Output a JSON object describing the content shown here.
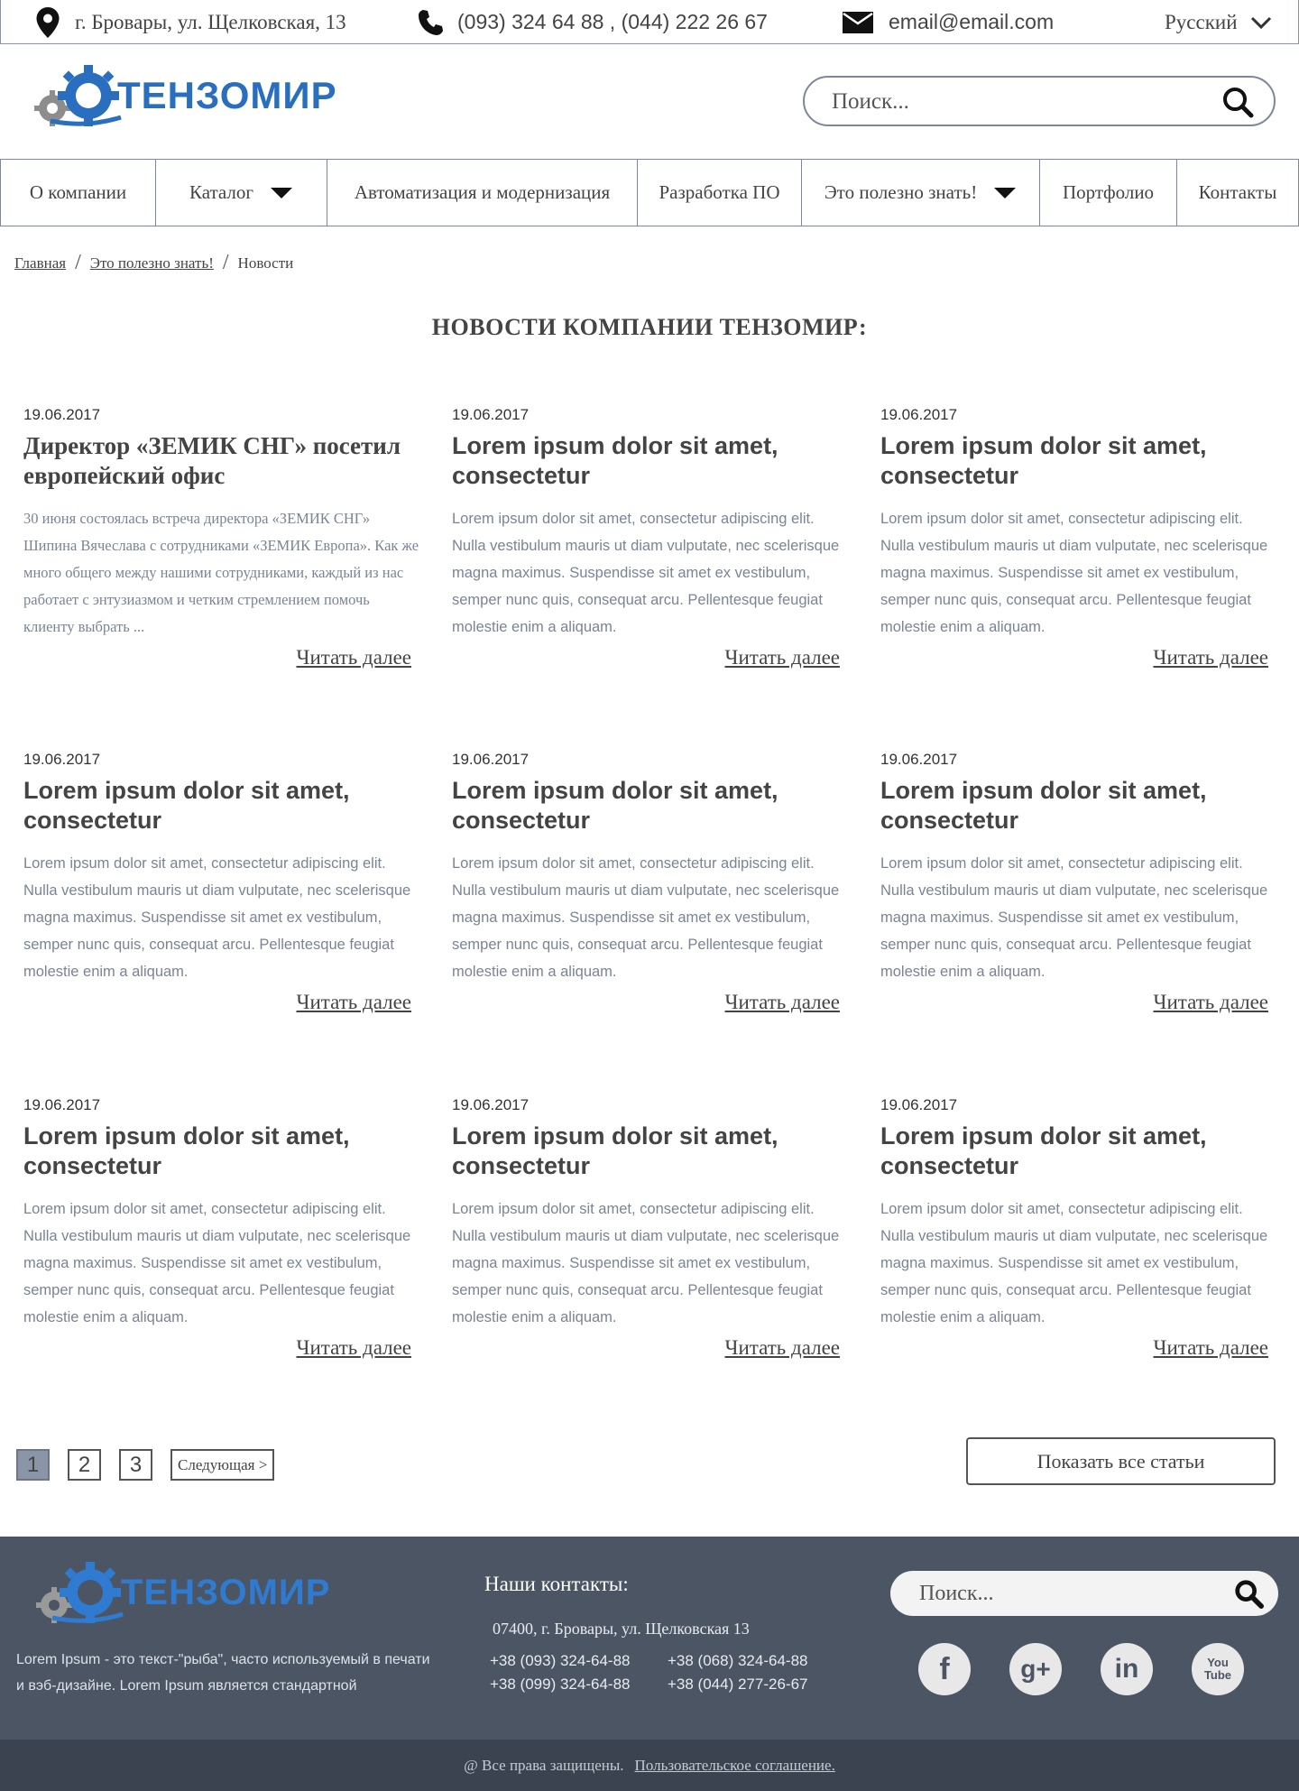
{
  "topbar": {
    "address": "г. Бровары, ул. Щелковская, 13",
    "phones": "(093) 324 64 88 , (044) 222 26 67",
    "email": "email@email.com",
    "language": "Русский"
  },
  "header": {
    "logo_text": "ТЕНЗОМИР",
    "search_placeholder": "Поиск..."
  },
  "nav": [
    {
      "label": "О компании",
      "dropdown": false
    },
    {
      "label": "Каталог",
      "dropdown": true
    },
    {
      "label": "Автоматизация и модернизация",
      "dropdown": false
    },
    {
      "label": "Разработка ПО",
      "dropdown": false
    },
    {
      "label": "Это полезно знать!",
      "dropdown": true
    },
    {
      "label": "Портфолио",
      "dropdown": false
    },
    {
      "label": "Контакты",
      "dropdown": false
    }
  ],
  "breadcrumb": {
    "home": "Главная",
    "section": "Это полезно знать!",
    "current": "Новости",
    "separator": "/"
  },
  "page_title": "НОВОСТИ КОМПАНИИ ТЕНЗОМИР:",
  "read_more": "Читать далее",
  "news": [
    {
      "date": "19.06.2017",
      "title": "Директор «ЗЕМИК СНГ» посетил европейский офис",
      "excerpt": "30 июня состоялась встреча директора «ЗЕМИК СНГ» Шипина Вячеслава с сотрудниками «ЗЕМИК Европа». Как же много общего между нашими сотрудниками, каждый из нас работает с энтузиазмом и четким стремлением помочь клиенту выбрать ..."
    },
    {
      "date": "19.06.2017",
      "title": "Lorem ipsum dolor sit amet, consectetur",
      "excerpt": "Lorem ipsum dolor sit amet, consectetur adipiscing elit. Nulla vestibulum mauris ut diam vulputate, nec scelerisque magna maximus. Suspendisse sit amet ex vestibulum, semper nunc quis, consequat arcu. Pellentesque feugiat molestie enim a aliquam."
    },
    {
      "date": "19.06.2017",
      "title": "Lorem ipsum dolor sit amet, consectetur",
      "excerpt": "Lorem ipsum dolor sit amet, consectetur adipiscing elit. Nulla vestibulum mauris ut diam vulputate, nec scelerisque magna maximus. Suspendisse sit amet ex vestibulum, semper nunc quis, consequat arcu. Pellentesque feugiat molestie enim a aliquam."
    },
    {
      "date": "19.06.2017",
      "title": "Lorem ipsum dolor sit amet, consectetur",
      "excerpt": "Lorem ipsum dolor sit amet, consectetur adipiscing elit. Nulla vestibulum mauris ut diam vulputate, nec scelerisque magna maximus. Suspendisse sit amet ex vestibulum, semper nunc quis, consequat arcu. Pellentesque feugiat molestie enim a aliquam."
    },
    {
      "date": "19.06.2017",
      "title": "Lorem ipsum dolor sit amet, consectetur",
      "excerpt": "Lorem ipsum dolor sit amet, consectetur adipiscing elit. Nulla vestibulum mauris ut diam vulputate, nec scelerisque magna maximus. Suspendisse sit amet ex vestibulum, semper nunc quis, consequat arcu. Pellentesque feugiat molestie enim a aliquam."
    },
    {
      "date": "19.06.2017",
      "title": "Lorem ipsum dolor sit amet, consectetur",
      "excerpt": "Lorem ipsum dolor sit amet, consectetur adipiscing elit. Nulla vestibulum mauris ut diam vulputate, nec scelerisque magna maximus. Suspendisse sit amet ex vestibulum, semper nunc quis, consequat arcu. Pellentesque feugiat molestie enim a aliquam."
    },
    {
      "date": "19.06.2017",
      "title": "Lorem ipsum dolor sit amet, consectetur",
      "excerpt": "Lorem ipsum dolor sit amet, consectetur adipiscing elit. Nulla vestibulum mauris ut diam vulputate, nec scelerisque magna maximus. Suspendisse sit amet ex vestibulum, semper nunc quis, consequat arcu. Pellentesque feugiat molestie enim a aliquam."
    },
    {
      "date": "19.06.2017",
      "title": "Lorem ipsum dolor sit amet, consectetur",
      "excerpt": "Lorem ipsum dolor sit amet, consectetur adipiscing elit. Nulla vestibulum mauris ut diam vulputate, nec scelerisque magna maximus. Suspendisse sit amet ex vestibulum, semper nunc quis, consequat arcu. Pellentesque feugiat molestie enim a aliquam."
    },
    {
      "date": "19.06.2017",
      "title": "Lorem ipsum dolor sit amet, consectetur",
      "excerpt": "Lorem ipsum dolor sit amet, consectetur adipiscing elit. Nulla vestibulum mauris ut diam vulputate, nec scelerisque magna maximus. Suspendisse sit amet ex vestibulum, semper nunc quis, consequat arcu. Pellentesque feugiat molestie enim a aliquam."
    }
  ],
  "pagination": {
    "pages": [
      "1",
      "2",
      "3"
    ],
    "current": "1",
    "next_label": "Следующая >"
  },
  "show_all_label": "Показать все статьи",
  "footer": {
    "logo_text": "ТЕНЗОМИР",
    "about": "Lorem Ipsum - это текст-\"рыба\", часто используемый в печати и вэб-дизайне. Lorem Ipsum является стандартной",
    "contacts_title": "Наши контакты:",
    "address": "07400, г. Бровары, ул. Щелковская 13",
    "phones": [
      "+38 (093) 324-64-88",
      "+38 (068) 324-64-88",
      "+38 (099) 324-64-88",
      "+38 (044) 277-26-67"
    ],
    "search_placeholder": "Поиск...",
    "socials": [
      {
        "name": "facebook-icon",
        "glyph": "f"
      },
      {
        "name": "google-plus-icon",
        "glyph": "g+"
      },
      {
        "name": "linkedin-icon",
        "glyph": "in"
      },
      {
        "name": "youtube-icon",
        "glyph": "You Tube"
      }
    ]
  },
  "copyright": {
    "text": "@ Все права защищены.",
    "link": "Пользовательское соглашение."
  },
  "colors": {
    "brand_blue": "#2a6fbf",
    "footer_bg": "#4c5563",
    "copyright_bg": "#3b4350",
    "border": "#7e8798",
    "excerpt_text": "#7b8494",
    "active_page": "#8b95a8"
  }
}
